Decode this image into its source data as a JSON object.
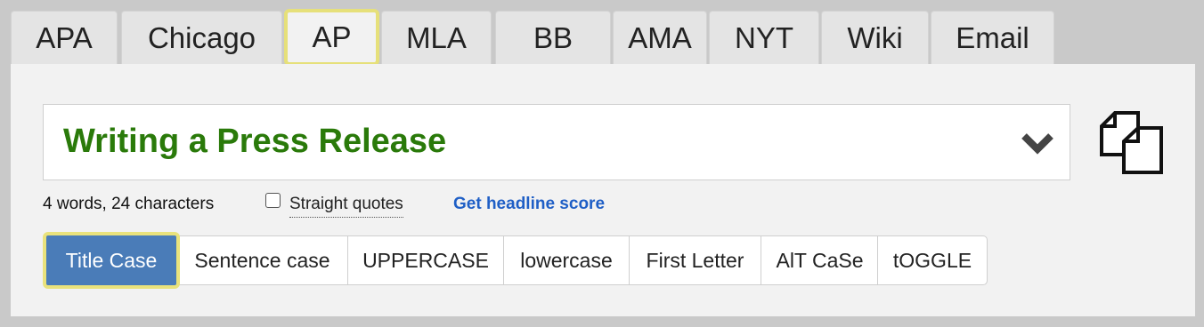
{
  "style_tabs": [
    {
      "label": "APA",
      "active": false
    },
    {
      "label": "Chicago",
      "active": false
    },
    {
      "label": "AP",
      "active": true
    },
    {
      "label": "MLA",
      "active": false
    },
    {
      "label": "BB",
      "active": false
    },
    {
      "label": "AMA",
      "active": false
    },
    {
      "label": "NYT",
      "active": false
    },
    {
      "label": "Wiki",
      "active": false
    },
    {
      "label": "Email",
      "active": false
    }
  ],
  "editor": {
    "text": "Writing a Press Release",
    "text_color": "#2a7a0a",
    "expand_icon": "chevron-down-icon",
    "copy_icon": "copy-icon"
  },
  "meta": {
    "counts": "4 words, 24 characters",
    "straight_quotes_label": "Straight quotes",
    "straight_quotes_checked": false,
    "headline_score_link": "Get headline score",
    "link_color": "#1f5fc6"
  },
  "case_buttons": [
    {
      "label": "Title Case",
      "active": true
    },
    {
      "label": "Sentence case",
      "active": false
    },
    {
      "label": "UPPERCASE",
      "active": false
    },
    {
      "label": "lowercase",
      "active": false
    },
    {
      "label": "First Letter",
      "active": false
    },
    {
      "label": "AlT CaSe",
      "active": false
    },
    {
      "label": "tOGGLE",
      "active": false
    }
  ],
  "colors": {
    "active_button": "#4a7cb8",
    "highlight": "#e6e07a"
  }
}
